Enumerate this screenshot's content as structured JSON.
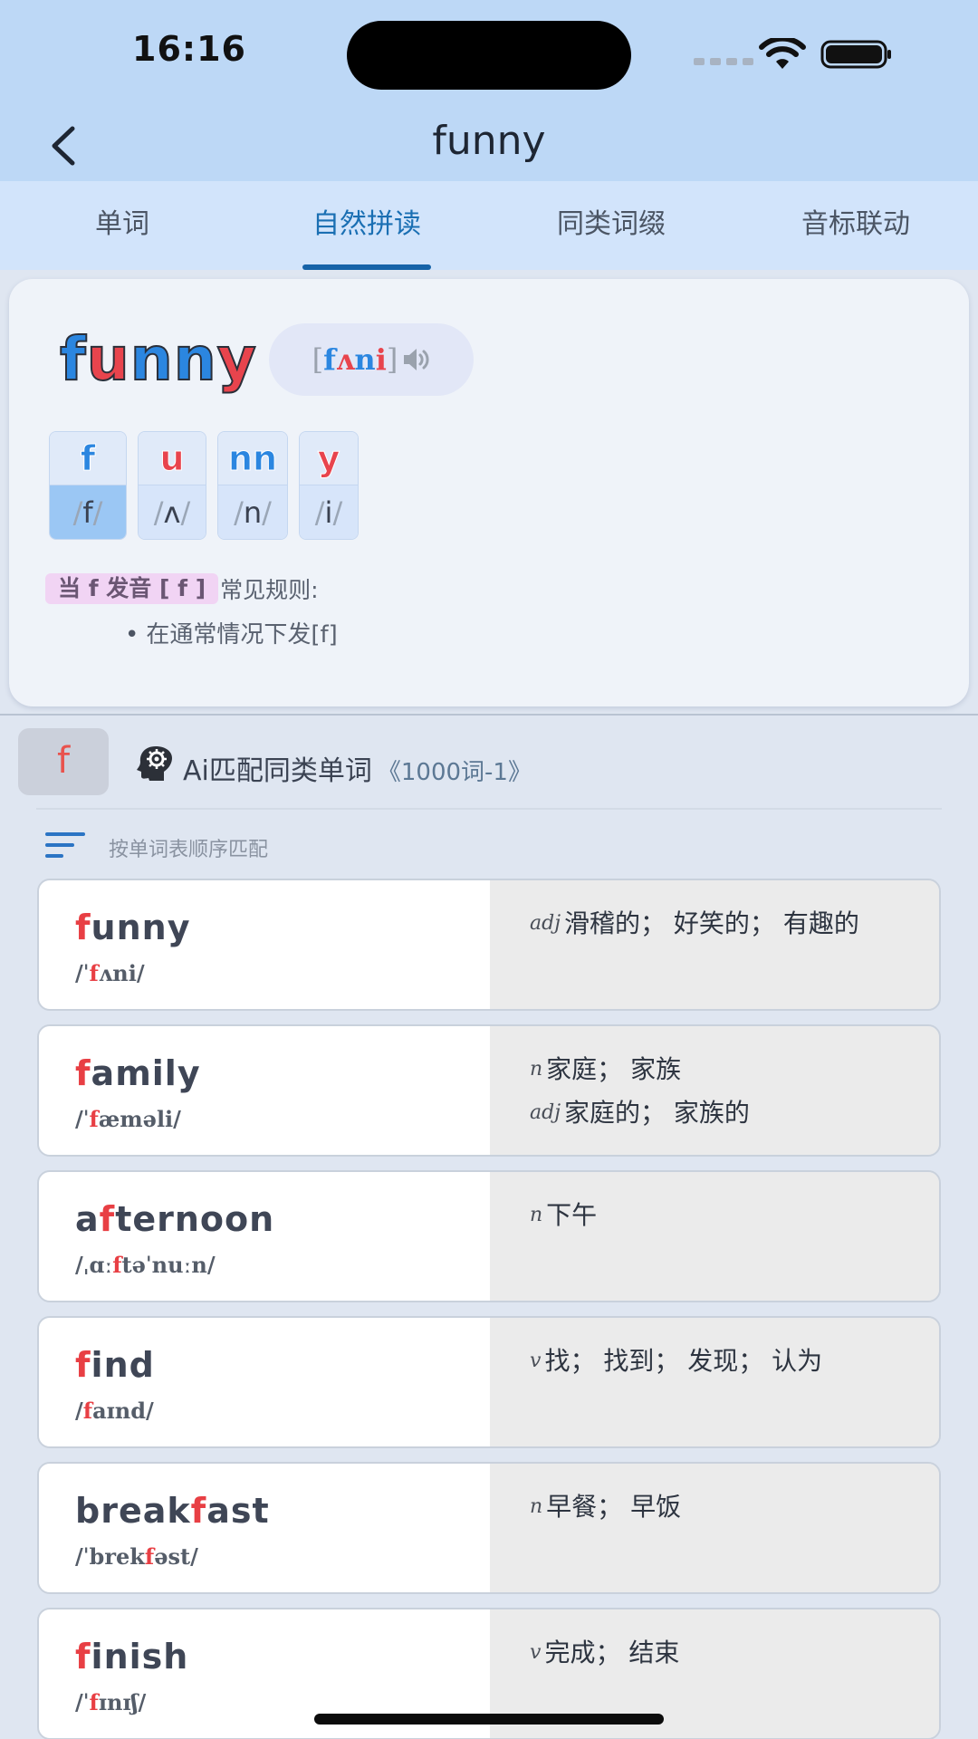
{
  "status": {
    "time": "16:16"
  },
  "nav": {
    "title": "funny"
  },
  "tabs": [
    {
      "label": "单词"
    },
    {
      "label": "自然拼读",
      "active": true
    },
    {
      "label": "同类词缀"
    },
    {
      "label": "音标联动"
    }
  ],
  "word": {
    "parts": [
      {
        "text": "f",
        "color": "blue"
      },
      {
        "text": "u",
        "color": "red"
      },
      {
        "text": "nn",
        "color": "blue"
      },
      {
        "text": "y",
        "color": "red"
      }
    ],
    "phonetic": {
      "open": "[",
      "segments": [
        "f",
        "ʌ",
        "n",
        "i"
      ],
      "close": "]"
    }
  },
  "tiles": [
    {
      "letter": "f",
      "sound": "f",
      "color": "blue",
      "selected": true
    },
    {
      "letter": "u",
      "sound": "ʌ",
      "color": "red",
      "selected": false
    },
    {
      "letter": "nn",
      "sound": "n",
      "color": "blue",
      "selected": false
    },
    {
      "letter": "y",
      "sound": "i",
      "color": "red",
      "selected": false
    }
  ],
  "rule": {
    "highlight": "当 f 发音 [ f ]",
    "suffix": "常见规则:",
    "items": [
      "在通常情况下发[f]"
    ]
  },
  "match": {
    "letter": "f",
    "title": "Ai匹配同类单词",
    "book": "《1000词-1》",
    "sort_label": "按单词表顺序匹配"
  },
  "words": [
    {
      "spell": [
        {
          "t": "f",
          "hl": true
        },
        {
          "t": "unny",
          "hl": false
        }
      ],
      "phon": [
        {
          "t": "/ˈ",
          "hl": false
        },
        {
          "t": "f",
          "hl": true
        },
        {
          "t": "ʌni/",
          "hl": false
        }
      ],
      "defs": [
        {
          "pos": "adj",
          "text": "滑稽的； 好笑的； 有趣的"
        }
      ]
    },
    {
      "spell": [
        {
          "t": "f",
          "hl": true
        },
        {
          "t": "amily",
          "hl": false
        }
      ],
      "phon": [
        {
          "t": "/ˈ",
          "hl": false
        },
        {
          "t": "f",
          "hl": true
        },
        {
          "t": "æməli/",
          "hl": false
        }
      ],
      "defs": [
        {
          "pos": "n",
          "text": "家庭； 家族"
        },
        {
          "pos": "adj",
          "text": "家庭的； 家族的"
        }
      ]
    },
    {
      "spell": [
        {
          "t": "a",
          "hl": false
        },
        {
          "t": "f",
          "hl": true
        },
        {
          "t": "ternoon",
          "hl": false
        }
      ],
      "phon": [
        {
          "t": "/ˌɑː",
          "hl": false
        },
        {
          "t": "f",
          "hl": true
        },
        {
          "t": "təˈnuːn/",
          "hl": false
        }
      ],
      "defs": [
        {
          "pos": "n",
          "text": "下午"
        }
      ]
    },
    {
      "spell": [
        {
          "t": "f",
          "hl": true
        },
        {
          "t": "ind",
          "hl": false
        }
      ],
      "phon": [
        {
          "t": "/",
          "hl": false
        },
        {
          "t": "f",
          "hl": true
        },
        {
          "t": "aɪnd/",
          "hl": false
        }
      ],
      "defs": [
        {
          "pos": "v",
          "text": "找； 找到； 发现； 认为"
        }
      ]
    },
    {
      "spell": [
        {
          "t": "break",
          "hl": false
        },
        {
          "t": "f",
          "hl": true
        },
        {
          "t": "ast",
          "hl": false
        }
      ],
      "phon": [
        {
          "t": "/ˈbrek",
          "hl": false
        },
        {
          "t": "f",
          "hl": true
        },
        {
          "t": "əst/",
          "hl": false
        }
      ],
      "defs": [
        {
          "pos": "n",
          "text": "早餐； 早饭"
        }
      ]
    },
    {
      "spell": [
        {
          "t": "f",
          "hl": true
        },
        {
          "t": "inish",
          "hl": false
        }
      ],
      "phon": [
        {
          "t": "/ˈ",
          "hl": false
        },
        {
          "t": "f",
          "hl": true
        },
        {
          "t": "ɪnɪʃ/",
          "hl": false
        }
      ],
      "defs": [
        {
          "pos": "v",
          "text": "完成； 结束"
        }
      ]
    }
  ]
}
